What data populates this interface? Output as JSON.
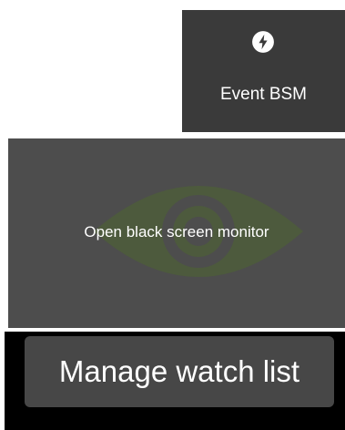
{
  "event_bsm": {
    "label": "Event BSM",
    "icon": "lightning-bolt-icon"
  },
  "monitor": {
    "label": "Open black screen monitor",
    "icon": "eye-icon",
    "icon_color": "#4d5a3d",
    "background": "#4d4d4d"
  },
  "watch_list": {
    "label": "Manage watch list"
  }
}
